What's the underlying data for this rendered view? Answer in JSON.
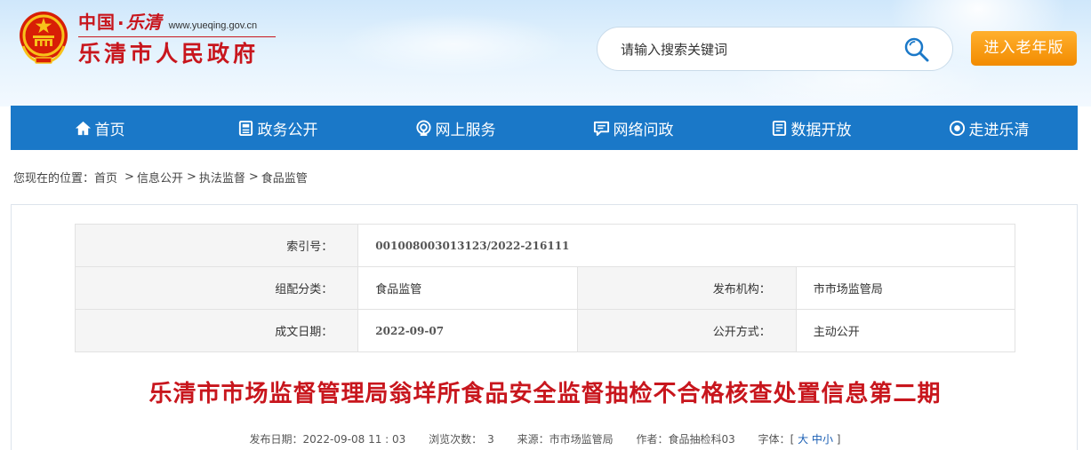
{
  "header": {
    "logo_country": "中国",
    "logo_dot": "·",
    "logo_city": "乐清",
    "logo_url": "www.yueqing.gov.cn",
    "logo_name": "乐清市人民政府",
    "search_placeholder": "请输入搜索关键词",
    "elder_button": "进入老年版"
  },
  "nav": {
    "items": [
      {
        "label": "首页",
        "icon": "home-icon"
      },
      {
        "label": "政务公开",
        "icon": "document-icon"
      },
      {
        "label": "网上服务",
        "icon": "service-icon"
      },
      {
        "label": "网络问政",
        "icon": "chat-icon"
      },
      {
        "label": "数据开放",
        "icon": "data-icon"
      },
      {
        "label": "走进乐清",
        "icon": "eye-icon"
      }
    ]
  },
  "breadcrumb": {
    "prefix": "您现在的位置：",
    "items": [
      "首页",
      "信息公开",
      "执法监督",
      "食品监管"
    ],
    "separator": ">"
  },
  "meta": {
    "index_label": "索引号：",
    "index_value": "001008003013123/2022-216111",
    "category_label": "组配分类：",
    "category_value": "食品监管",
    "publisher_label": "发布机构：",
    "publisher_value": "市市场监管局",
    "date_label": "成文日期：",
    "date_value": "2022-09-07",
    "method_label": "公开方式：",
    "method_value": "主动公开"
  },
  "article": {
    "title": "乐清市市场监督管理局翁垟所食品安全监督抽检不合格核查处置信息第二期",
    "publish_date": "发布日期：2022-09-08 11 : 03",
    "views_label": "浏览次数：",
    "views_value": "3",
    "source": "来源：市市场监管局",
    "author": "作者：食品抽检科03",
    "font_label": "字体：",
    "font_open": "[",
    "font_large": "大",
    "font_medium": "中",
    "font_small": "小",
    "font_close": "]"
  },
  "colors": {
    "brand_red": "#c8161d",
    "nav_blue": "#1a78c8",
    "elder_orange": "#f28b00"
  }
}
